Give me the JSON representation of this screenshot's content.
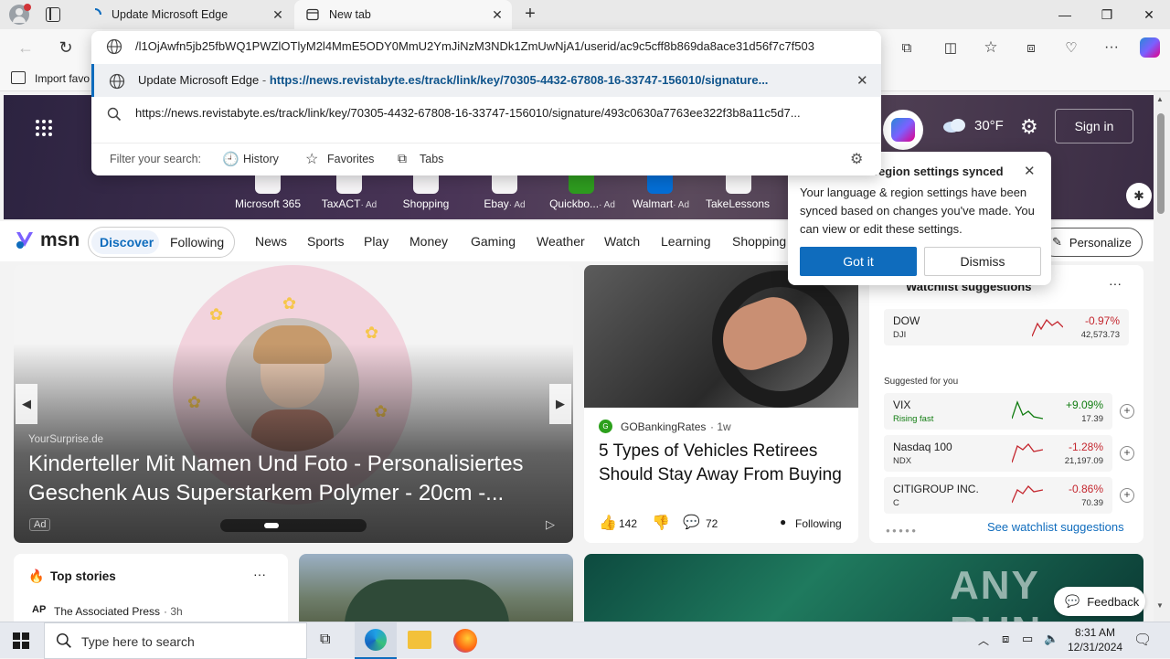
{
  "browser": {
    "tabs": [
      {
        "title": "Update Microsoft Edge"
      },
      {
        "title": "New tab"
      }
    ],
    "address_bar_value": "/l1OjAwfn5jb25fbWQ1PWZlOTlyM2l4MmE5ODY0MmU2YmJiNzM3NDk1ZmUwNjA1/userid/ac9c5cff8b869da8ace31d56f7c7f503",
    "suggestions": [
      {
        "title": "Update Microsoft Edge",
        "separator": "-",
        "url": "https://news.revistabyte.es/track/link/key/70305-4432-67808-16-33747-156010/signature..."
      },
      {
        "url": "https://news.revistabyte.es/track/link/key/70305-4432-67808-16-33747-156010/signature/493c0630a7763ee322f3b8a11c5d7..."
      }
    ],
    "filter_label": "Filter your search:",
    "filters": [
      "History",
      "Favorites",
      "Tabs"
    ],
    "bookmark_import": "Import favo"
  },
  "msn": {
    "weather": "30°F",
    "sign_in": "Sign in",
    "quick_links": [
      {
        "label": "Microsoft 365",
        "ad": ""
      },
      {
        "label": "TaxACT",
        "ad": "· Ad"
      },
      {
        "label": "Shopping",
        "ad": ""
      },
      {
        "label": "Ebay",
        "ad": "· Ad"
      },
      {
        "label": "Quickbo...",
        "ad": "· Ad"
      },
      {
        "label": "Walmart",
        "ad": "· Ad"
      },
      {
        "label": "TakeLessons",
        "ad": ""
      }
    ],
    "logo": "msn",
    "nav_toggle": [
      "Discover",
      "Following"
    ],
    "nav_items": [
      "News",
      "Sports",
      "Play",
      "Money",
      "Gaming",
      "Weather",
      "Watch",
      "Learning",
      "Shopping"
    ],
    "personalize": "Personalize",
    "carousel": {
      "source": "YourSurprise.de",
      "title": "Kinderteller Mit Namen Und Foto - Personalisiertes Geschenk Aus Superstarkem Polymer - 20cm -...",
      "ad_badge": "Ad"
    },
    "article": {
      "source": "GOBankingRates",
      "age": "· 1w",
      "title": "5 Types of Vehicles Retirees Should Stay Away From Buying",
      "likes": "142",
      "comments": "72",
      "following": "Following"
    },
    "watchlist": {
      "title": "Watchlist suggestions",
      "suggested_label": "Suggested for you",
      "link": "See watchlist suggestions",
      "top": {
        "name": "DOW",
        "sub": "DJI",
        "change": "-0.97%",
        "value": "42,573.73"
      },
      "items": [
        {
          "name": "VIX",
          "sub": "Rising fast",
          "change": "+9.09%",
          "value": "17.39",
          "up": true
        },
        {
          "name": "Nasdaq 100",
          "sub": "NDX",
          "change": "-1.28%",
          "value": "21,197.09",
          "up": false
        },
        {
          "name": "CITIGROUP INC.",
          "sub": "C",
          "change": "-0.86%",
          "value": "70.39",
          "up": false
        }
      ]
    },
    "top_stories": {
      "title": "Top stories",
      "source": "The Associated Press",
      "age": "· 3h"
    },
    "feedback": "Feedback",
    "popup": {
      "title": "region settings synced",
      "body": "Your language & region settings have been synced based on changes you've made. You can view or edit these settings.",
      "primary": "Got it",
      "secondary": "Dismiss"
    },
    "watermark": "ANY RUN"
  },
  "taskbar": {
    "search_placeholder": "Type here to search",
    "time": "8:31 AM",
    "date": "12/31/2024"
  },
  "colors": {
    "accent": "#0f6cbd",
    "negative": "#c4262e",
    "positive": "#107c10"
  }
}
